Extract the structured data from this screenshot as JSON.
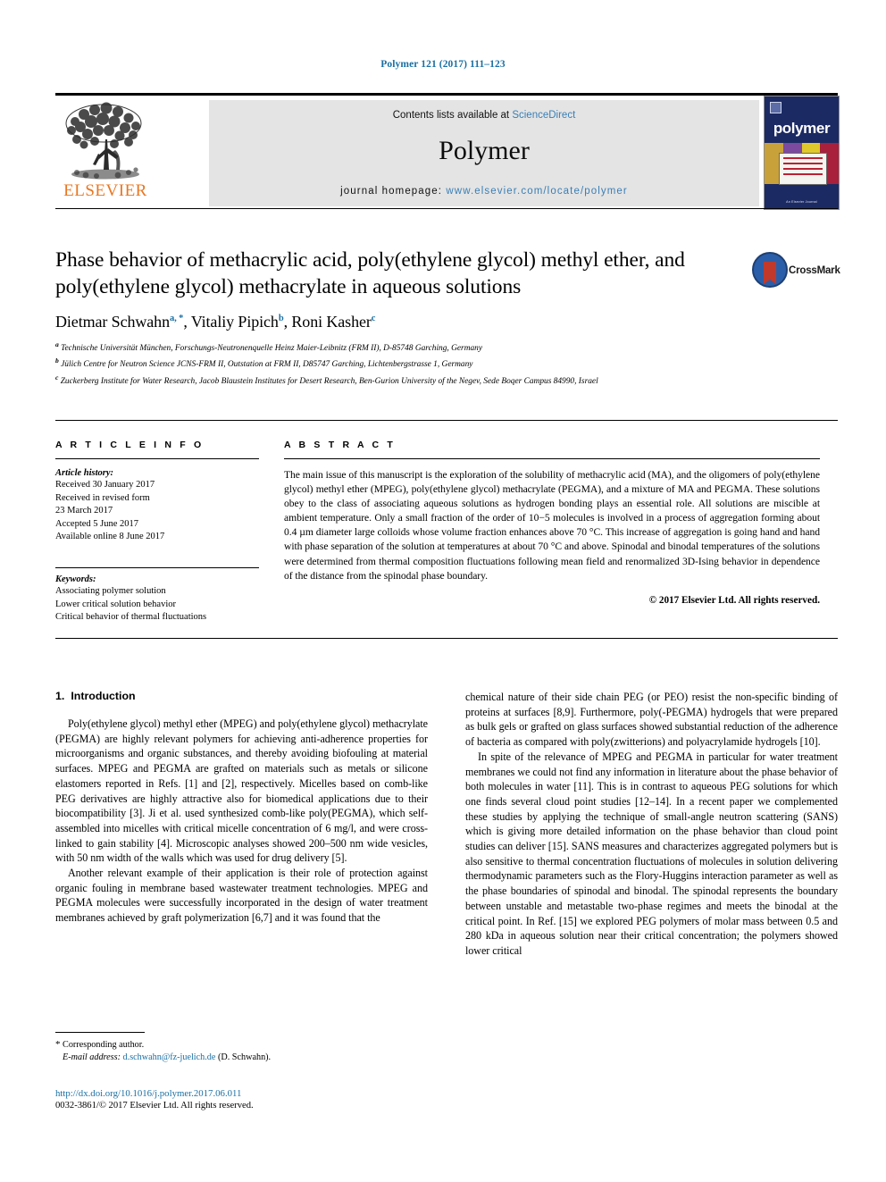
{
  "running_head": "Polymer 121 (2017) 111–123",
  "masthead": {
    "publisher_name": "ELSEVIER",
    "tree_logo_icon": "elsevier-tree-icon",
    "contents_prefix": "Contents lists available at ",
    "contents_link": "ScienceDirect",
    "journal_name": "Polymer",
    "homepage_prefix": "journal homepage: ",
    "homepage_url": "www.elsevier.com/locate/polymer",
    "cover": {
      "title": "polymer",
      "footer_text": "An Elsevier Journal"
    }
  },
  "article": {
    "title": "Phase behavior of methacrylic acid, poly(ethylene glycol) methyl ether, and poly(ethylene glycol) methacrylate in aqueous solutions",
    "crossmark_label": "CrossMark",
    "authors": [
      {
        "name": "Dietmar Schwahn",
        "marks": "a, *"
      },
      {
        "name": "Vitaliy Pipich",
        "marks": "b"
      },
      {
        "name": "Roni Kasher",
        "marks": "c"
      }
    ],
    "affiliations": [
      {
        "mark": "a",
        "text": "Technische Universität München, Forschungs-Neutronenquelle Heinz Maier-Leibnitz (FRM II), D-85748 Garching, Germany"
      },
      {
        "mark": "b",
        "text": "Jülich Centre for Neutron Science JCNS-FRM II, Outstation at FRM II, D85747 Garching, Lichtenbergstrasse 1, Germany"
      },
      {
        "mark": "c",
        "text": "Zuckerberg Institute for Water Research, Jacob Blaustein Institutes for Desert Research, Ben-Gurion University of the Negev, Sede Boqer Campus 84990, Israel"
      }
    ]
  },
  "article_info": {
    "heading": "A R T I C L E   I N F O",
    "history_label": "Article history:",
    "history": [
      "Received 30 January 2017",
      "Received in revised form",
      "23 March 2017",
      "Accepted 5 June 2017",
      "Available online 8 June 2017"
    ],
    "keywords_label": "Keywords:",
    "keywords": [
      "Associating polymer solution",
      "Lower critical solution behavior",
      "Critical behavior of thermal fluctuations"
    ]
  },
  "abstract": {
    "heading": "A B S T R A C T",
    "text": "The main issue of this manuscript is the exploration of the solubility of methacrylic acid (MA), and the oligomers of poly(ethylene glycol) methyl ether (MPEG), poly(ethylene glycol) methacrylate (PEGMA), and a mixture of MA and PEGMA. These solutions obey to the class of associating aqueous solutions as hydrogen bonding plays an essential role. All solutions are miscible at ambient temperature. Only a small fraction of the order of 10−5 molecules is involved in a process of aggregation forming about 0.4 µm diameter large colloids whose volume fraction enhances above 70 °C. This increase of aggregation is going hand and hand with phase separation of the solution at temperatures at about 70 °C and above. Spinodal and binodal temperatures of the solutions were determined from thermal composition fluctuations following mean field and renormalized 3D-Ising behavior in dependence of the distance from the spinodal phase boundary.",
    "copyright": "© 2017 Elsevier Ltd. All rights reserved."
  },
  "introduction": {
    "number": "1.",
    "title": "Introduction",
    "left_paragraphs": [
      "Poly(ethylene glycol) methyl ether (MPEG) and poly(ethylene glycol) methacrylate (PEGMA) are highly relevant polymers for achieving anti-adherence properties for microorganisms and organic substances, and thereby avoiding biofouling at material surfaces. MPEG and PEGMA are grafted on materials such as metals or silicone elastomers reported in Refs. [1] and [2], respectively. Micelles based on comb-like PEG derivatives are highly attractive also for biomedical applications due to their biocompatibility [3]. Ji et al. used synthesized comb-like poly(PEGMA), which self-assembled into micelles with critical micelle concentration of 6 mg/l, and were cross-linked to gain stability [4]. Microscopic analyses showed 200–500 nm wide vesicles, with 50 nm width of the walls which was used for drug delivery [5].",
      "Another relevant example of their application is their role of protection against organic fouling in membrane based wastewater treatment technologies. MPEG and PEGMA molecules were successfully incorporated in the design of water treatment membranes achieved by graft polymerization [6,7] and it was found that the"
    ],
    "right_paragraphs": [
      "chemical nature of their side chain PEG (or PEO) resist the non-specific binding of proteins at surfaces [8,9]. Furthermore, poly(-PEGMA) hydrogels that were prepared as bulk gels or grafted on glass surfaces showed substantial reduction of the adherence of bacteria as compared with poly(zwitterions) and polyacrylamide hydrogels [10].",
      "In spite of the relevance of MPEG and PEGMA in particular for water treatment membranes we could not find any information in literature about the phase behavior of both molecules in water [11]. This is in contrast to aqueous PEG solutions for which one finds several cloud point studies [12–14]. In a recent paper we complemented these studies by applying the technique of small-angle neutron scattering (SANS) which is giving more detailed information on the phase behavior than cloud point studies can deliver [15]. SANS measures and characterizes aggregated polymers but is also sensitive to thermal concentration fluctuations of molecules in solution delivering thermodynamic parameters such as the Flory-Huggins interaction parameter as well as the phase boundaries of spinodal and binodal. The spinodal represents the boundary between unstable and metastable two-phase regimes and meets the binodal at the critical point. In Ref. [15] we explored PEG polymers of molar mass between 0.5 and 280 kDa in aqueous solution near their critical concentration; the polymers showed lower critical"
    ]
  },
  "footnote": {
    "corresponding_author": "Corresponding author.",
    "email_label": "E-mail address:",
    "email": "d.schwahn@fz-juelich.de",
    "email_owner": "(D. Schwahn)."
  },
  "footer": {
    "doi": "http://dx.doi.org/10.1016/j.polymer.2017.06.011",
    "issn_line": "0032-3861/© 2017 Elsevier Ltd. All rights reserved."
  },
  "colors": {
    "link_blue": "#1a6fa3",
    "elsevier_orange": "#E87722",
    "banner_gray": "#e4e4e4",
    "cover_navy": "#1b2a63"
  }
}
